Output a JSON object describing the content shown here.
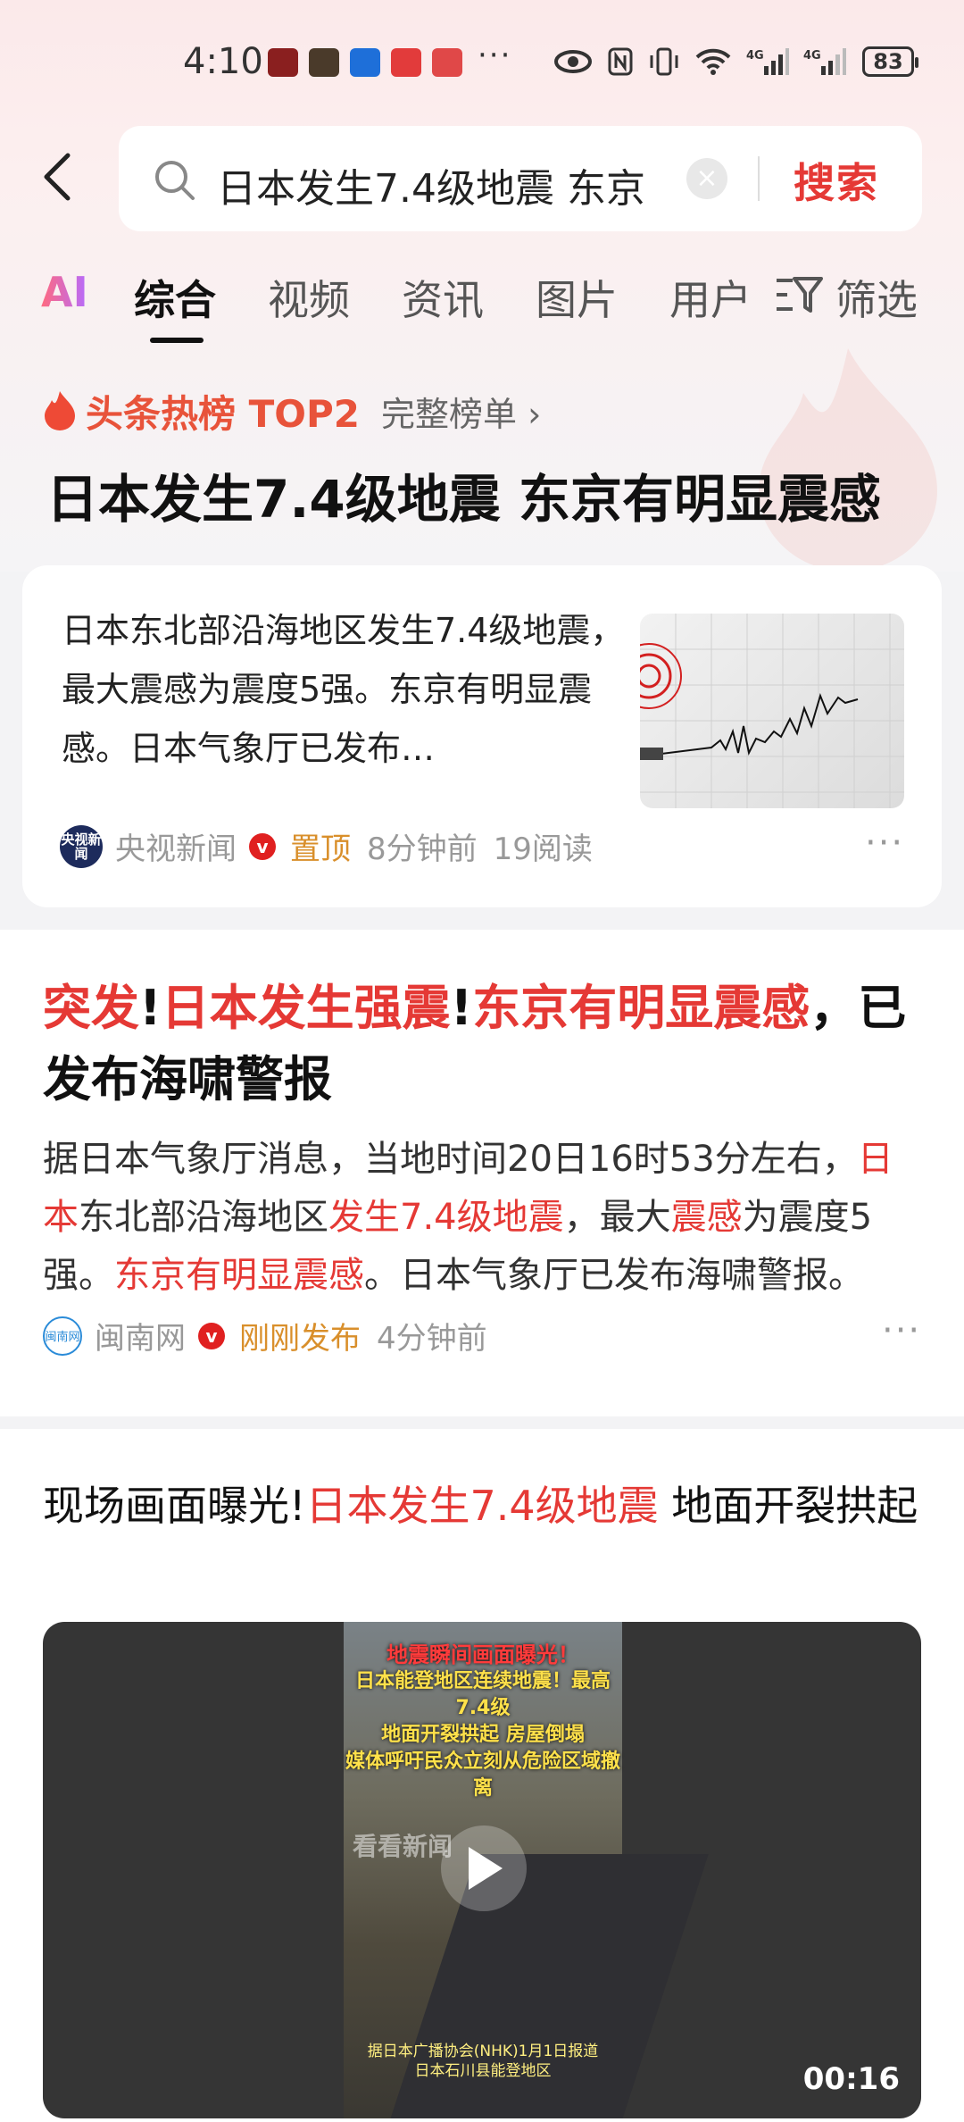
{
  "status_bar": {
    "time": "4:10",
    "more": "···",
    "battery": "83"
  },
  "search": {
    "query": "日本发生7.4级地震 东京",
    "clear": "×",
    "button": "搜索"
  },
  "tabs": [
    {
      "label": "AI"
    },
    {
      "label": "综合"
    },
    {
      "label": "视频"
    },
    {
      "label": "资讯"
    },
    {
      "label": "图片"
    },
    {
      "label": "用户"
    },
    {
      "label": "筛选"
    }
  ],
  "hot": {
    "label": "头条热榜 TOP2",
    "full_list": "完整榜单 ›",
    "title": "日本发生7.4级地震 东京有明显震感"
  },
  "card1": {
    "text": "日本东北部沿海地区发生7.4级地震，最大震感为震度5强。东京有明显震感。日本气象厅已发布…",
    "source_avatar": "央视新闻",
    "source": "央视新闻",
    "badge": "v",
    "pinned": "置顶",
    "time": "8分钟前",
    "reads": "19阅读",
    "more": "···"
  },
  "article2": {
    "title_parts": [
      "突发",
      "!",
      "日本发生强震",
      "!",
      "东京有明显震感",
      "，已发布海啸警报"
    ],
    "body_parts": [
      "据日本气象厅消息，当地时间20日16时53分左右，",
      "日本",
      "东北部沿海地区",
      "发生7.4级地震",
      "，最大",
      "震感",
      "为震度5强。",
      "东京有明显震感",
      "。日本气象厅已发布海啸警报。"
    ],
    "source_avatar": "闽南网",
    "source": "闽南网",
    "badge": "v",
    "tag": "刚刚发布",
    "time": "4分钟前",
    "more": "···"
  },
  "article3": {
    "title_parts": [
      "现场画面曝光!",
      "日本发生7.4级地震",
      " 地面开裂拱起"
    ],
    "video": {
      "caption_1": "地震瞬间画面曝光！",
      "caption_2": "日本能登地区连续地震！最高7.4级",
      "caption_3": "地面开裂拱起  房屋倒塌",
      "caption_4": "媒体呼吁民众立刻从危险区域撤离",
      "watermark": "看看新闻",
      "footer_1": "据日本广播协会(NHK)1月1日报道",
      "footer_2": "日本石川县能登地区",
      "duration": "00:16"
    }
  },
  "colors": {
    "accent": "#e53935",
    "hot": "#e8533a",
    "pin": "#d98f2b"
  }
}
